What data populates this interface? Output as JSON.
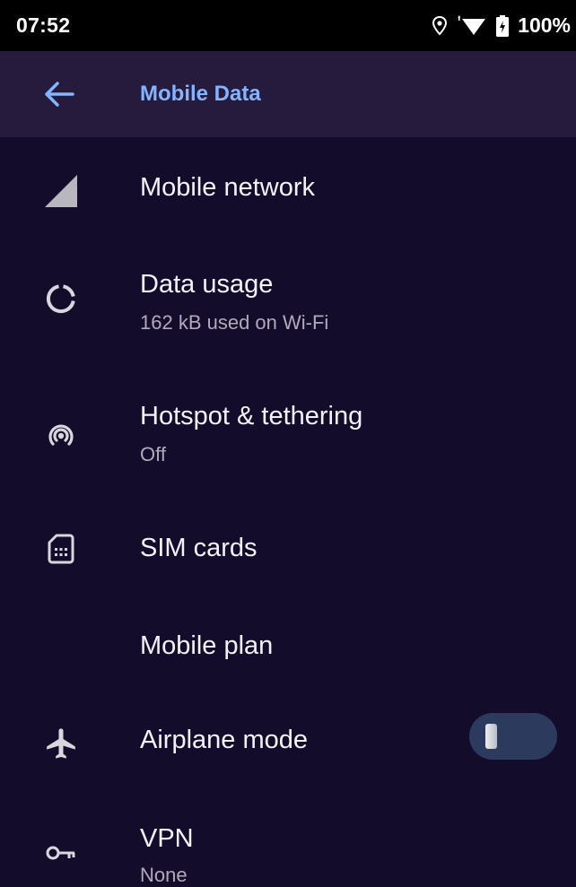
{
  "status_bar": {
    "time": "07:52",
    "battery": "100%",
    "icons": [
      "location-icon",
      "wifi-icon",
      "battery-icon"
    ]
  },
  "app_bar": {
    "title": "Mobile Data",
    "back_icon": "back-arrow-icon"
  },
  "colors": {
    "background": "#140c2b",
    "app_bar": "#261b3d",
    "accent": "#82b4ff",
    "subtitle": "#b0aaba",
    "toggle_track": "#2c3a5e"
  },
  "settings": [
    {
      "title": "Mobile network",
      "subtitle": "",
      "icon": "signal-icon"
    },
    {
      "title": "Data usage",
      "subtitle": "162 kB used on Wi-Fi",
      "icon": "data-usage-icon"
    },
    {
      "title": "Hotspot & tethering",
      "subtitle": "Off",
      "icon": "hotspot-icon"
    },
    {
      "title": "SIM cards",
      "subtitle": "",
      "icon": "sim-card-icon"
    },
    {
      "title": "Mobile plan",
      "subtitle": ""
    },
    {
      "title": "Airplane mode",
      "subtitle": "",
      "icon": "airplane-icon",
      "toggle": "off"
    },
    {
      "title": "VPN",
      "subtitle": "None",
      "icon": "vpn-key-icon"
    }
  ]
}
